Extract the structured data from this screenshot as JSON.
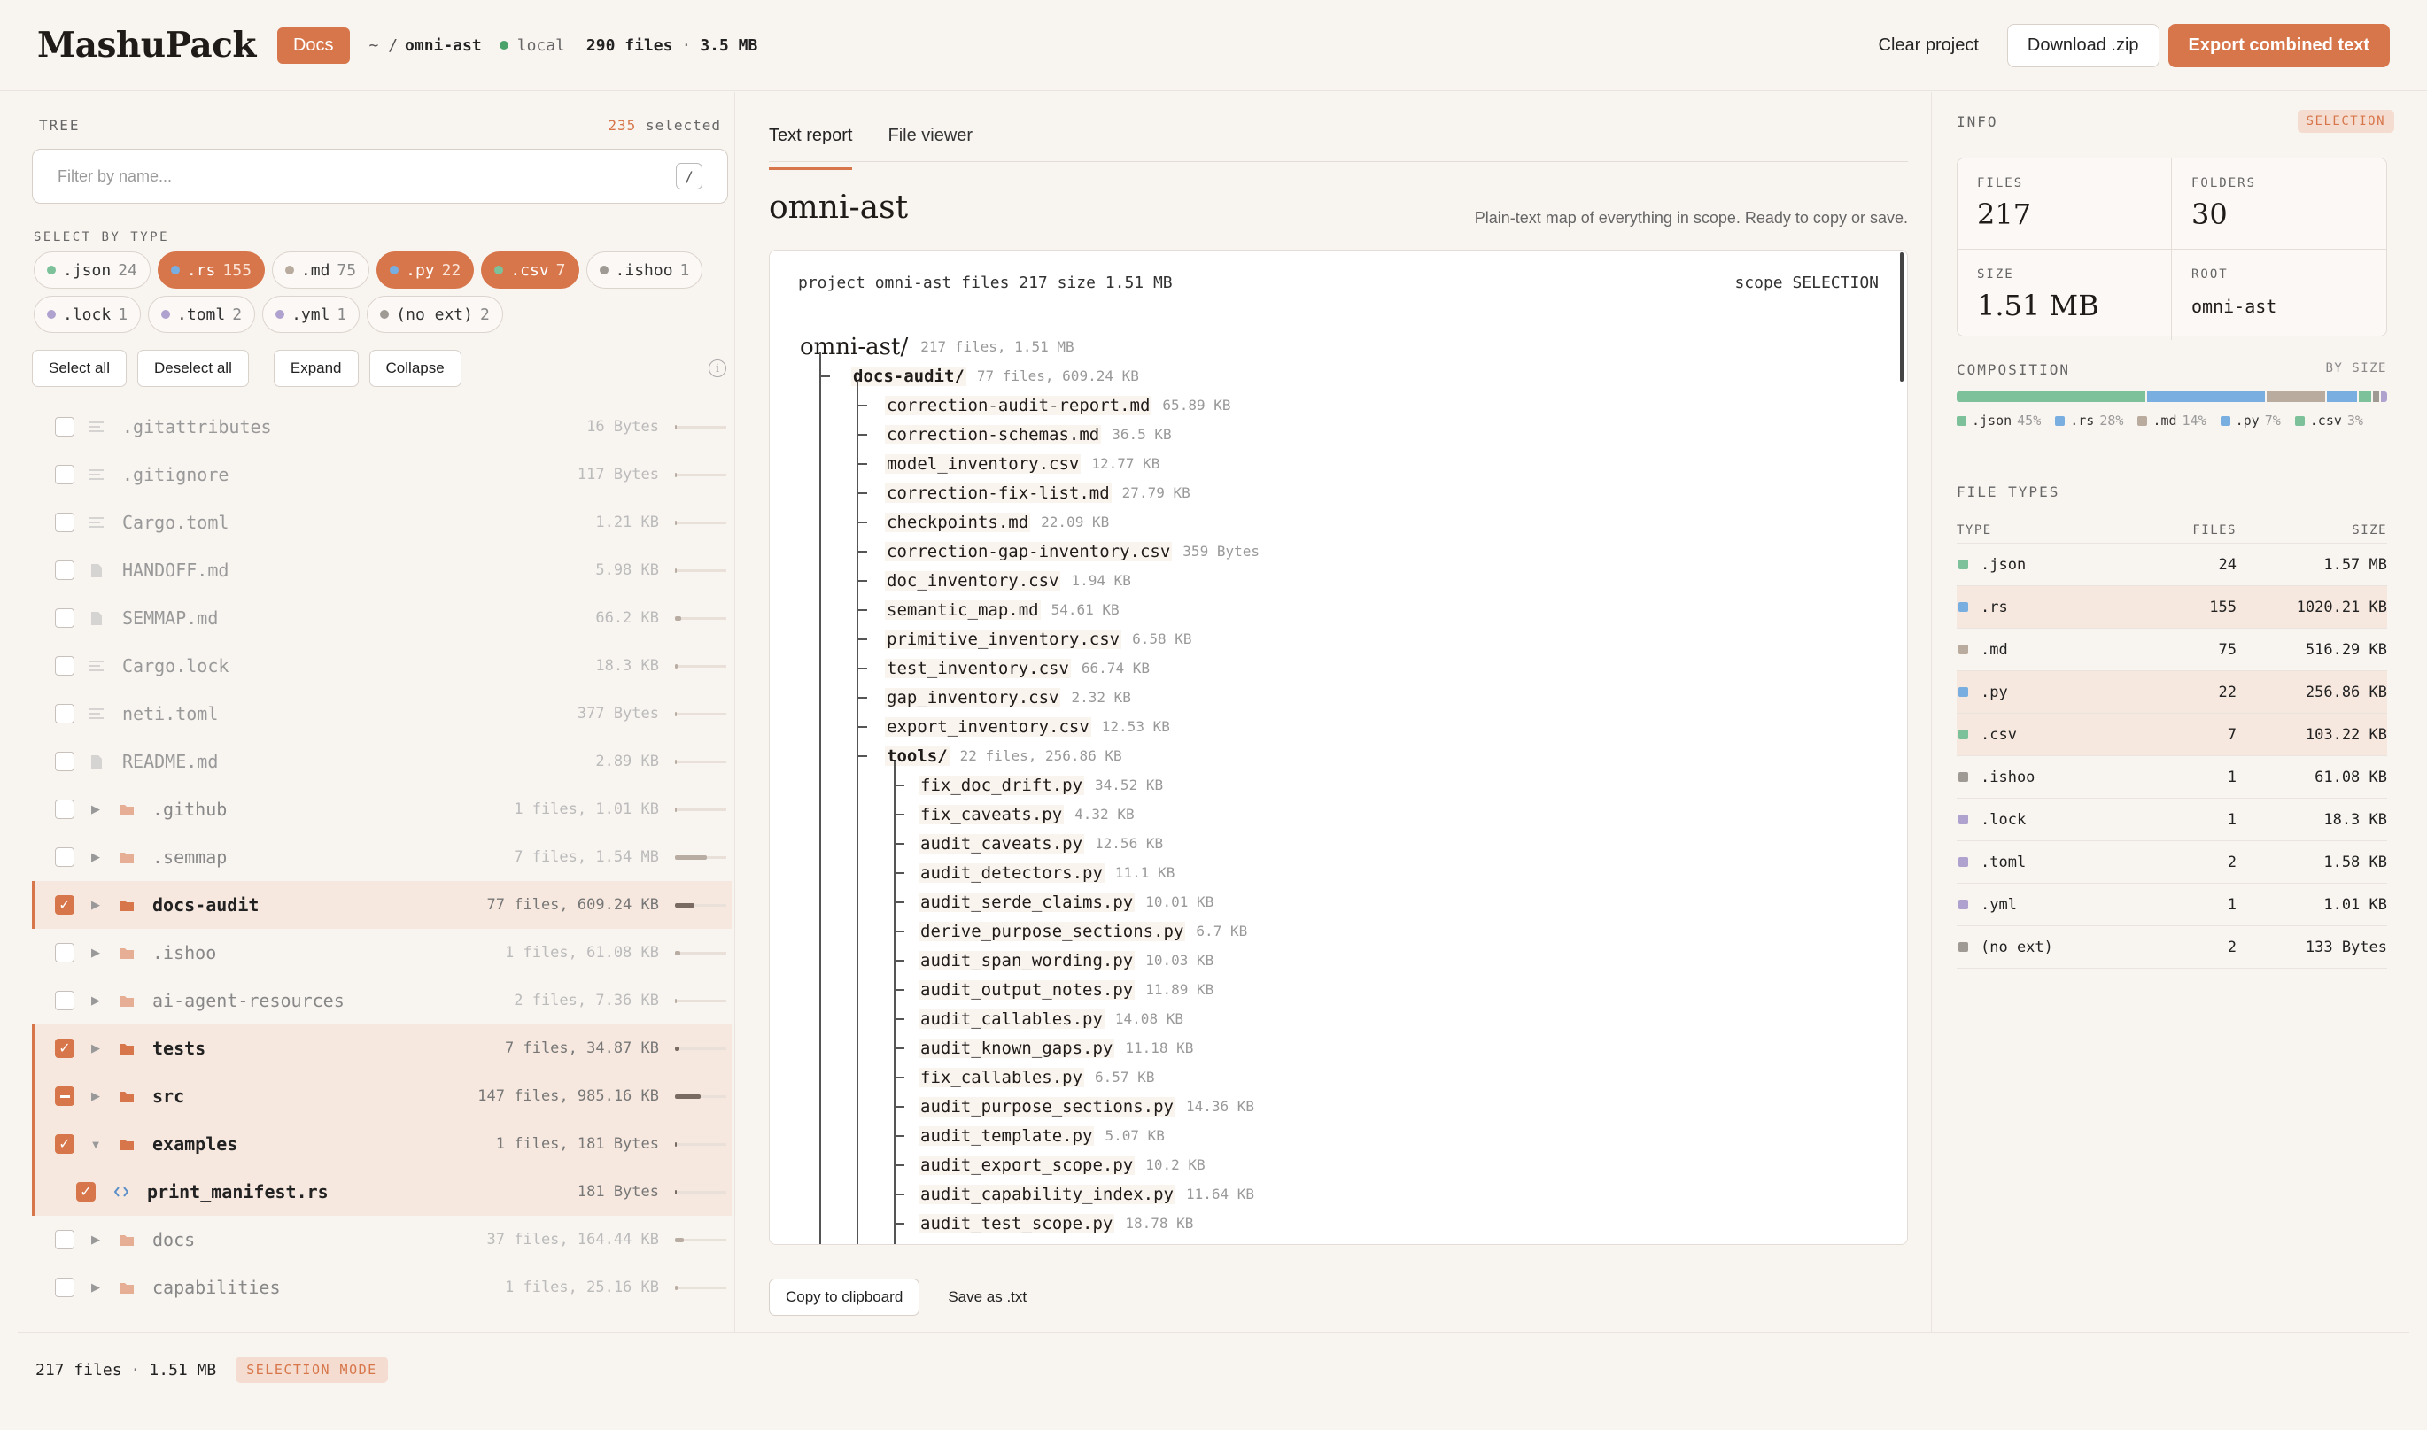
{
  "header": {
    "logo": "MashuPack",
    "docs_badge": "Docs",
    "path_prefix": "~ /",
    "project": "omni-ast",
    "location": "local",
    "file_count": "290 files",
    "separator": "·",
    "total_size": "3.5 MB",
    "clear_label": "Clear project",
    "download_label": "Download .zip",
    "export_label": "Export combined text"
  },
  "tree": {
    "title": "TREE",
    "selected_count": "235",
    "selected_label": "selected",
    "filter_placeholder": "Filter by name...",
    "filter_shortcut": "/",
    "select_by_type_label": "SELECT BY TYPE",
    "chips": [
      {
        "ext": ".json",
        "count": "24",
        "color": "#7cc19a",
        "on": false
      },
      {
        "ext": ".rs",
        "count": "155",
        "color": "#79aee0",
        "on": true
      },
      {
        "ext": ".md",
        "count": "75",
        "color": "#b9ab9e",
        "on": false
      },
      {
        "ext": ".py",
        "count": "22",
        "color": "#79aee0",
        "on": true
      },
      {
        "ext": ".csv",
        "count": "7",
        "color": "#7cc19a",
        "on": true
      },
      {
        "ext": ".ishoo",
        "count": "1",
        "color": "#a09a94",
        "on": false
      },
      {
        "ext": ".lock",
        "count": "1",
        "color": "#b0a2cf",
        "on": false
      },
      {
        "ext": ".toml",
        "count": "2",
        "color": "#b0a2cf",
        "on": false
      },
      {
        "ext": ".yml",
        "count": "1",
        "color": "#b0a2cf",
        "on": false
      },
      {
        "ext": "(no ext)",
        "count": "2",
        "color": "#a09a94",
        "on": false
      }
    ],
    "select_all": "Select all",
    "deselect_all": "Deselect all",
    "expand": "Expand",
    "collapse": "Collapse",
    "rows": [
      {
        "name": ".gitattributes",
        "meta": "16 Bytes",
        "kind": "file-lines",
        "check": "none",
        "fill": 0.02
      },
      {
        "name": ".gitignore",
        "meta": "117 Bytes",
        "kind": "file-lines",
        "check": "none",
        "fill": 0.02
      },
      {
        "name": "Cargo.toml",
        "meta": "1.21 KB",
        "kind": "file-lines",
        "check": "none",
        "fill": 0.03
      },
      {
        "name": "HANDOFF.md",
        "meta": "5.98 KB",
        "kind": "file-doc",
        "check": "none",
        "fill": 0.04
      },
      {
        "name": "SEMMAP.md",
        "meta": "66.2 KB",
        "kind": "file-doc",
        "check": "none",
        "fill": 0.12
      },
      {
        "name": "Cargo.lock",
        "meta": "18.3 KB",
        "kind": "file-lines",
        "check": "none",
        "fill": 0.06
      },
      {
        "name": "neti.toml",
        "meta": "377 Bytes",
        "kind": "file-lines",
        "check": "none",
        "fill": 0.02
      },
      {
        "name": "README.md",
        "meta": "2.89 KB",
        "kind": "file-doc",
        "check": "none",
        "fill": 0.03
      },
      {
        "name": ".github",
        "meta": "1 files, 1.01 KB",
        "kind": "folder",
        "check": "none",
        "fill": 0.03
      },
      {
        "name": ".semmap",
        "meta": "7 files, 1.54 MB",
        "kind": "folder",
        "check": "none",
        "fill": 0.62
      },
      {
        "name": "docs-audit",
        "meta": "77 files, 609.24 KB",
        "kind": "folder",
        "check": "on",
        "fill": 0.38
      },
      {
        "name": ".ishoo",
        "meta": "1 files, 61.08 KB",
        "kind": "folder",
        "check": "none",
        "fill": 0.1
      },
      {
        "name": "ai-agent-resources",
        "meta": "2 files, 7.36 KB",
        "kind": "folder",
        "check": "none",
        "fill": 0.04
      },
      {
        "name": "tests",
        "meta": "7 files, 34.87 KB",
        "kind": "folder",
        "check": "on",
        "fill": 0.08
      },
      {
        "name": "src",
        "meta": "147 files, 985.16 KB",
        "kind": "folder",
        "check": "part",
        "fill": 0.5
      },
      {
        "name": "examples",
        "meta": "1 files, 181 Bytes",
        "kind": "folder-open",
        "check": "on",
        "fill": 0.02
      },
      {
        "name": "print_manifest.rs",
        "meta": "181 Bytes",
        "kind": "rust",
        "check": "on",
        "fill": 0.02
      },
      {
        "name": "docs",
        "meta": "37 files, 164.44 KB",
        "kind": "folder",
        "check": "none",
        "fill": 0.18
      },
      {
        "name": "capabilities",
        "meta": "1 files, 25.16 KB",
        "kind": "folder",
        "check": "none",
        "fill": 0.06
      }
    ]
  },
  "footer": {
    "count": "217 files",
    "separator": "·",
    "size": "1.51 MB",
    "mode": "SELECTION MODE"
  },
  "main": {
    "tabs": [
      "Text report",
      "File viewer"
    ],
    "title": "omni-ast",
    "subtitle": "Plain-text map of everything in scope. Ready to copy or save.",
    "report_head": "project omni-ast files 217 size 1.51 MB",
    "report_scope": "scope SELECTION",
    "report_lines": [
      {
        "d": 0,
        "name": "omni-ast/",
        "meta": "217 files, 1.51 MB",
        "root": true
      },
      {
        "d": 1,
        "name": "docs-audit/",
        "meta": "77 files, 609.24 KB",
        "dir": true
      },
      {
        "d": 2,
        "name": "correction-audit-report.md",
        "meta": "65.89 KB"
      },
      {
        "d": 2,
        "name": "correction-schemas.md",
        "meta": "36.5 KB"
      },
      {
        "d": 2,
        "name": "model_inventory.csv",
        "meta": "12.77 KB"
      },
      {
        "d": 2,
        "name": "correction-fix-list.md",
        "meta": "27.79 KB"
      },
      {
        "d": 2,
        "name": "checkpoints.md",
        "meta": "22.09 KB"
      },
      {
        "d": 2,
        "name": "correction-gap-inventory.csv",
        "meta": "359 Bytes"
      },
      {
        "d": 2,
        "name": "doc_inventory.csv",
        "meta": "1.94 KB"
      },
      {
        "d": 2,
        "name": "semantic_map.md",
        "meta": "54.61 KB"
      },
      {
        "d": 2,
        "name": "primitive_inventory.csv",
        "meta": "6.58 KB"
      },
      {
        "d": 2,
        "name": "test_inventory.csv",
        "meta": "66.74 KB"
      },
      {
        "d": 2,
        "name": "gap_inventory.csv",
        "meta": "2.32 KB"
      },
      {
        "d": 2,
        "name": "export_inventory.csv",
        "meta": "12.53 KB"
      },
      {
        "d": 2,
        "name": "tools/",
        "meta": "22 files, 256.86 KB",
        "dir": true
      },
      {
        "d": 3,
        "name": "fix_doc_drift.py",
        "meta": "34.52 KB"
      },
      {
        "d": 3,
        "name": "fix_caveats.py",
        "meta": "4.32 KB"
      },
      {
        "d": 3,
        "name": "audit_caveats.py",
        "meta": "12.56 KB"
      },
      {
        "d": 3,
        "name": "audit_detectors.py",
        "meta": "11.1 KB"
      },
      {
        "d": 3,
        "name": "audit_serde_claims.py",
        "meta": "10.01 KB"
      },
      {
        "d": 3,
        "name": "derive_purpose_sections.py",
        "meta": "6.7 KB"
      },
      {
        "d": 3,
        "name": "audit_span_wording.py",
        "meta": "10.03 KB"
      },
      {
        "d": 3,
        "name": "audit_output_notes.py",
        "meta": "11.89 KB"
      },
      {
        "d": 3,
        "name": "audit_callables.py",
        "meta": "14.08 KB"
      },
      {
        "d": 3,
        "name": "audit_known_gaps.py",
        "meta": "11.18 KB"
      },
      {
        "d": 3,
        "name": "fix_callables.py",
        "meta": "6.57 KB"
      },
      {
        "d": 3,
        "name": "audit_purpose_sections.py",
        "meta": "14.36 KB"
      },
      {
        "d": 3,
        "name": "audit_template.py",
        "meta": "5.07 KB"
      },
      {
        "d": 3,
        "name": "audit_export_scope.py",
        "meta": "10.2 KB"
      },
      {
        "d": 3,
        "name": "audit_capability_index.py",
        "meta": "11.64 KB"
      },
      {
        "d": 3,
        "name": "audit_test_scope.py",
        "meta": "18.78 KB"
      }
    ],
    "copy_label": "Copy to clipboard",
    "save_label": "Save as .txt"
  },
  "info": {
    "title": "INFO",
    "badge": "SELECTION",
    "stats": [
      {
        "label": "FILES",
        "value": "217",
        "mono": false
      },
      {
        "label": "FOLDERS",
        "value": "30",
        "mono": false
      },
      {
        "label": "SIZE",
        "value": "1.51 MB",
        "mono": false
      },
      {
        "label": "ROOT",
        "value": "omni-ast",
        "mono": true
      }
    ],
    "composition_label": "COMPOSITION",
    "composition_sort": "BY SIZE",
    "composition": [
      {
        "ext": ".json",
        "pct": 45,
        "pct_label": "45%",
        "color": "#7cc19a",
        "legend": true
      },
      {
        "ext": ".rs",
        "pct": 28,
        "pct_label": "28%",
        "color": "#79aee0",
        "legend": true
      },
      {
        "ext": ".md",
        "pct": 14,
        "pct_label": "14%",
        "color": "#b9ab9e",
        "legend": true
      },
      {
        "ext": ".py",
        "pct": 7,
        "pct_label": "7%",
        "color": "#79aee0",
        "legend": true
      },
      {
        "ext": ".csv",
        "pct": 3,
        "pct_label": "3%",
        "color": "#7cc19a",
        "legend": true
      },
      {
        "ext": ".ishoo",
        "pct": 1.6,
        "pct_label": "",
        "color": "#a09a94",
        "legend": false
      },
      {
        "ext": "rest",
        "pct": 1.4,
        "pct_label": "",
        "color": "#b0a2cf",
        "legend": false
      }
    ],
    "file_types_label": "FILE TYPES",
    "columns": [
      "TYPE",
      "FILES",
      "SIZE"
    ],
    "file_types": [
      {
        "type": ".json",
        "files": "24",
        "size": "1.57 MB",
        "color": "#7cc19a",
        "hi": false
      },
      {
        "type": ".rs",
        "files": "155",
        "size": "1020.21 KB",
        "color": "#79aee0",
        "hi": true
      },
      {
        "type": ".md",
        "files": "75",
        "size": "516.29 KB",
        "color": "#b9ab9e",
        "hi": false
      },
      {
        "type": ".py",
        "files": "22",
        "size": "256.86 KB",
        "color": "#79aee0",
        "hi": true
      },
      {
        "type": ".csv",
        "files": "7",
        "size": "103.22 KB",
        "color": "#7cc19a",
        "hi": true
      },
      {
        "type": ".ishoo",
        "files": "1",
        "size": "61.08 KB",
        "color": "#a09a94",
        "hi": false
      },
      {
        "type": ".lock",
        "files": "1",
        "size": "18.3 KB",
        "color": "#b0a2cf",
        "hi": false
      },
      {
        "type": ".toml",
        "files": "2",
        "size": "1.58 KB",
        "color": "#b0a2cf",
        "hi": false
      },
      {
        "type": ".yml",
        "files": "1",
        "size": "1.01 KB",
        "color": "#b0a2cf",
        "hi": false
      },
      {
        "type": "(no ext)",
        "files": "2",
        "size": "133 Bytes",
        "color": "#a09a94",
        "hi": false
      }
    ]
  }
}
